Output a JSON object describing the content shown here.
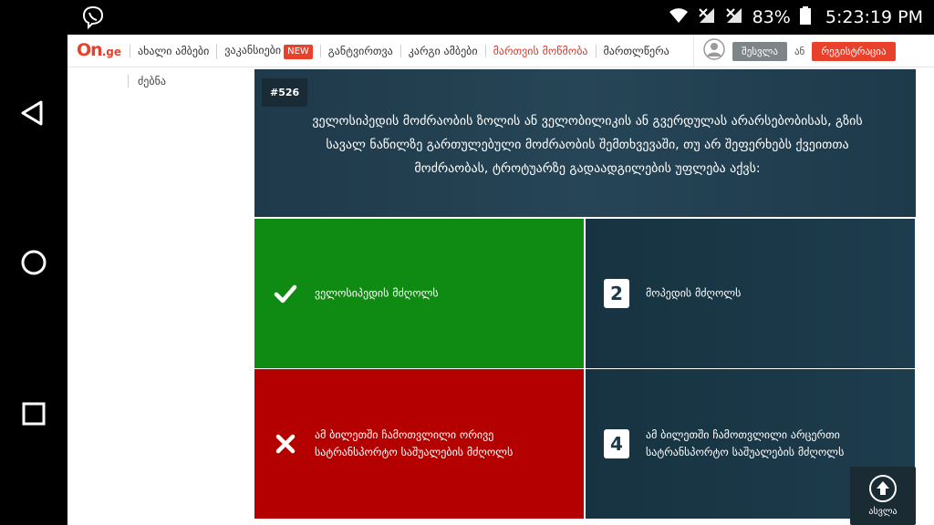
{
  "status": {
    "battery": "83%",
    "time": "5:23:19 PM"
  },
  "header": {
    "logo_main": "On",
    "logo_suffix": ".ge",
    "menu": [
      {
        "label": "ახალი ამბები"
      },
      {
        "label": "ვაკანსიები",
        "badge": "NEW"
      },
      {
        "label": "განტვირთვა"
      },
      {
        "label": "კარგი ამბები"
      },
      {
        "label": "მართვის მოწმობა"
      },
      {
        "label": "მართლწერა"
      }
    ],
    "login": "შესვლა",
    "or": "ან",
    "register": "რეგისტრაცია"
  },
  "subnav": {
    "label": "ძებნა"
  },
  "quiz": {
    "number": "#526",
    "question_line1": "ველოსიპედის მოძრაობის ზოლის ან ველობილიკის ან გვერდულას არარსებობისას, გზის",
    "question_line2": "სავალ ნაწილზე გართულებული მოძრაობის შემთხვევაში, თუ არ შეფერხებს ქვეითთა",
    "question_line3": "მოძრაობას, ტროტუარზე გადაადგილების უფლება აქვს:",
    "answers": [
      {
        "text": "ველოსიპედის მძღოლს",
        "state": "correct"
      },
      {
        "number": "2",
        "text": "მოპედის მძღოლს",
        "state": "neutral"
      },
      {
        "text": "ამ ბილეთში ჩამოთვლილი ორივე სატრანსპორტო საშუალების მძღოლს",
        "state": "wrong"
      },
      {
        "number": "4",
        "text": "ამ ბილეთში ჩამოთვლილი არცერთი სატრანსპორტო საშუალების მძღოლს",
        "state": "neutral"
      }
    ]
  },
  "scroll_top": {
    "label": "ასვლა"
  },
  "colors": {
    "brand": "#e8412c",
    "correct": "#0f8a12",
    "wrong": "#b50000",
    "question_bg": "#1f3a4a"
  }
}
